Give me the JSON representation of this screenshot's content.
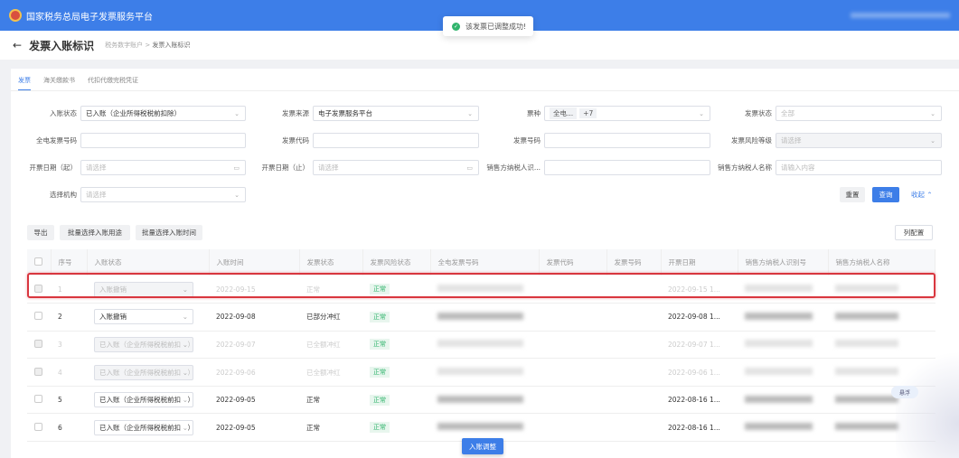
{
  "app": {
    "title": "国家税务总局电子发票服务平台"
  },
  "toast": {
    "message": "该发票已调整成功!"
  },
  "header": {
    "title": "发票入账标识",
    "breadcrumb": [
      "税务数字账户",
      "发票入账标识"
    ],
    "sep": ">"
  },
  "tabs": [
    "发票",
    "海关缴款书",
    "代扣代缴完税凭证"
  ],
  "filters": {
    "entry_status": {
      "label": "入账状态",
      "value": "已入账（企业所得税税前扣除）"
    },
    "source": {
      "label": "发票来源",
      "value": "电子发票服务平台"
    },
    "ticket_type": {
      "label": "票种",
      "tag": "全电...",
      "more": "+7"
    },
    "invoice_status": {
      "label": "发票状态",
      "placeholder": "全部"
    },
    "full_no": {
      "label": "全电发票号码"
    },
    "code": {
      "label": "发票代码"
    },
    "number": {
      "label": "发票号码"
    },
    "risk_level": {
      "label": "发票风险等级",
      "placeholder": "请选择"
    },
    "date_from": {
      "label": "开票日期（起）",
      "placeholder": "请选择"
    },
    "date_to": {
      "label": "开票日期（止）",
      "placeholder": "请选择"
    },
    "seller_id": {
      "label": "销售方纳税人识..."
    },
    "seller_name": {
      "label": "销售方纳税人名称",
      "placeholder": "请输入内容"
    },
    "org": {
      "label": "选择机构",
      "placeholder": "请选择"
    },
    "reset": "重置",
    "query": "查询",
    "collapse": "收起"
  },
  "toolbar": {
    "export": "导出",
    "batch_use": "批量选择入账用途",
    "batch_time": "批量选择入账时间",
    "columns": "列配置"
  },
  "table": {
    "headers": [
      "序号",
      "入账状态",
      "入账时间",
      "发票状态",
      "发票风险状态",
      "全电发票号码",
      "发票代码",
      "发票号码",
      "开票日期",
      "销售方纳税人识别号",
      "销售方纳税人名称"
    ],
    "rows": [
      {
        "no": "1",
        "entry": "入账撤销",
        "time": "2022-09-15",
        "status": "正常",
        "risk": "正常",
        "date": "2022-09-15 1...",
        "dim": true
      },
      {
        "no": "2",
        "entry": "入账撤销",
        "time": "2022-09-08",
        "status": "已部分冲红",
        "risk": "正常",
        "date": "2022-09-08 1...",
        "dim": false
      },
      {
        "no": "3",
        "entry": "已入账（企业所得税税前扣除）",
        "time": "2022-09-07",
        "status": "已全额冲红",
        "risk": "正常",
        "date": "2022-09-07 1...",
        "dim": true
      },
      {
        "no": "4",
        "entry": "已入账（企业所得税税前扣除）",
        "time": "2022-09-06",
        "status": "已全额冲红",
        "risk": "正常",
        "date": "2022-09-06 1...",
        "dim": true
      },
      {
        "no": "5",
        "entry": "已入账（企业所得税税前扣除）",
        "time": "2022-09-05",
        "status": "正常",
        "risk": "正常",
        "date": "2022-08-16 1...",
        "dim": false
      },
      {
        "no": "6",
        "entry": "已入账（企业所得税税前扣除）",
        "time": "2022-09-05",
        "status": "正常",
        "risk": "正常",
        "date": "2022-08-16 1...",
        "dim": false
      }
    ]
  },
  "float_button": "入账调整",
  "side_widget": "悬浮"
}
